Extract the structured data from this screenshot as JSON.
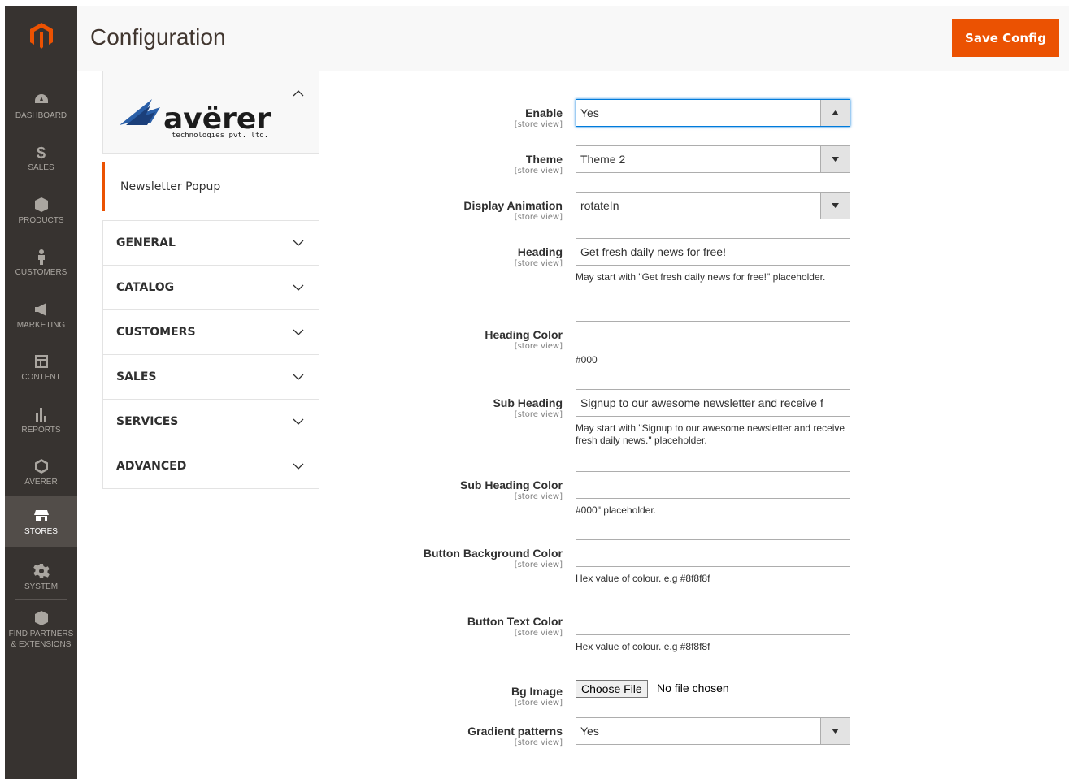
{
  "sidebar": {
    "items": [
      {
        "label": "DASHBOARD",
        "icon": "dashboard-icon"
      },
      {
        "label": "SALES",
        "icon": "dollar-icon"
      },
      {
        "label": "PRODUCTS",
        "icon": "box-icon"
      },
      {
        "label": "CUSTOMERS",
        "icon": "person-icon"
      },
      {
        "label": "MARKETING",
        "icon": "megaphone-icon"
      },
      {
        "label": "CONTENT",
        "icon": "layout-icon"
      },
      {
        "label": "REPORTS",
        "icon": "bar-chart-icon"
      },
      {
        "label": "AVERER",
        "icon": "hexagon-icon"
      },
      {
        "label": "STORES",
        "icon": "store-icon",
        "active": true
      },
      {
        "label": "SYSTEM",
        "icon": "gear-icon"
      },
      {
        "label": "FIND PARTNERS & EXTENSIONS",
        "icon": "cube-icon"
      }
    ]
  },
  "header": {
    "title": "Configuration",
    "save_label": "Save Config"
  },
  "config_tabs": {
    "brand": {
      "name": "avërer",
      "tagline": "technologies pvt. ltd."
    },
    "sub_item": "Newsletter Popup",
    "groups": [
      "GENERAL",
      "CATALOG",
      "CUSTOMERS",
      "SALES",
      "SERVICES",
      "ADVANCED"
    ]
  },
  "form": {
    "scope": "[store view]",
    "enable": {
      "label": "Enable",
      "value": "Yes"
    },
    "theme": {
      "label": "Theme",
      "value": "Theme 2"
    },
    "animation": {
      "label": "Display Animation",
      "value": "rotateIn"
    },
    "heading": {
      "label": "Heading",
      "value": "Get fresh daily news for free!",
      "note": "May start with \"Get fresh daily news for free!\" placeholder."
    },
    "heading_color": {
      "label": "Heading Color",
      "value": "",
      "note": "#000"
    },
    "sub_heading": {
      "label": "Sub Heading",
      "value": "Signup to our awesome newsletter and receive f",
      "note": "May start with \"Signup to our awesome newsletter and receive fresh daily news.\" placeholder."
    },
    "sub_heading_color": {
      "label": "Sub Heading Color",
      "value": "",
      "note": "#000\" placeholder."
    },
    "button_bg_color": {
      "label": "Button Background Color",
      "value": "",
      "note": "Hex value of colour. e.g #8f8f8f"
    },
    "button_text_color": {
      "label": "Button Text Color",
      "value": "",
      "note": "Hex value of colour. e.g #8f8f8f"
    },
    "bg_image": {
      "label": "Bg Image",
      "button": "Choose File",
      "status": "No file chosen"
    },
    "gradient": {
      "label": "Gradient patterns",
      "value": "Yes"
    }
  },
  "colors": {
    "accent": "#eb5202",
    "sidebar": "#373330",
    "focus": "#007bdb"
  }
}
